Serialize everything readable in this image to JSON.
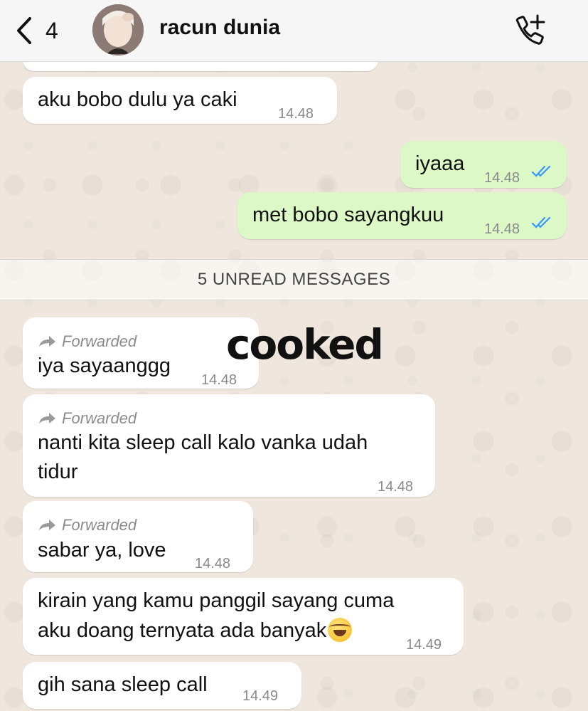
{
  "header": {
    "back_count": "4",
    "contact_name": "racun dunia"
  },
  "messages": [
    {
      "dir": "in",
      "text": "aku bobo dulu ya caki",
      "time": "14.48"
    },
    {
      "dir": "out",
      "text": "iyaaa",
      "time": "14.48",
      "status": "read"
    },
    {
      "dir": "out",
      "text": "met bobo sayangkuu",
      "time": "14.48",
      "status": "read"
    },
    {
      "dir": "in",
      "forwarded": "Forwarded",
      "text": "iya sayaanggg",
      "time": "14.48"
    },
    {
      "dir": "in",
      "forwarded": "Forwarded",
      "lines": [
        "nanti kita sleep call kalo vanka udah",
        "tidur"
      ],
      "time": "14.48"
    },
    {
      "dir": "in",
      "forwarded": "Forwarded",
      "text": "sabar ya, love",
      "time": "14.48"
    },
    {
      "dir": "in",
      "lines": [
        "kirain yang kamu panggil sayang cuma",
        "aku doang ternyata ada banyak"
      ],
      "emoji": "face-with-tears-of-joy",
      "time": "14.49"
    },
    {
      "dir": "in",
      "text": "gih sana sleep call",
      "time": "14.49"
    }
  ],
  "unread_divider": "5 UNREAD MESSAGES",
  "overlay_text": "cooked",
  "colors": {
    "outgoing_bubble": "#dcf8c6",
    "incoming_bubble": "#ffffff",
    "read_ticks": "#3497f9",
    "wallpaper": "#efe7dd"
  }
}
